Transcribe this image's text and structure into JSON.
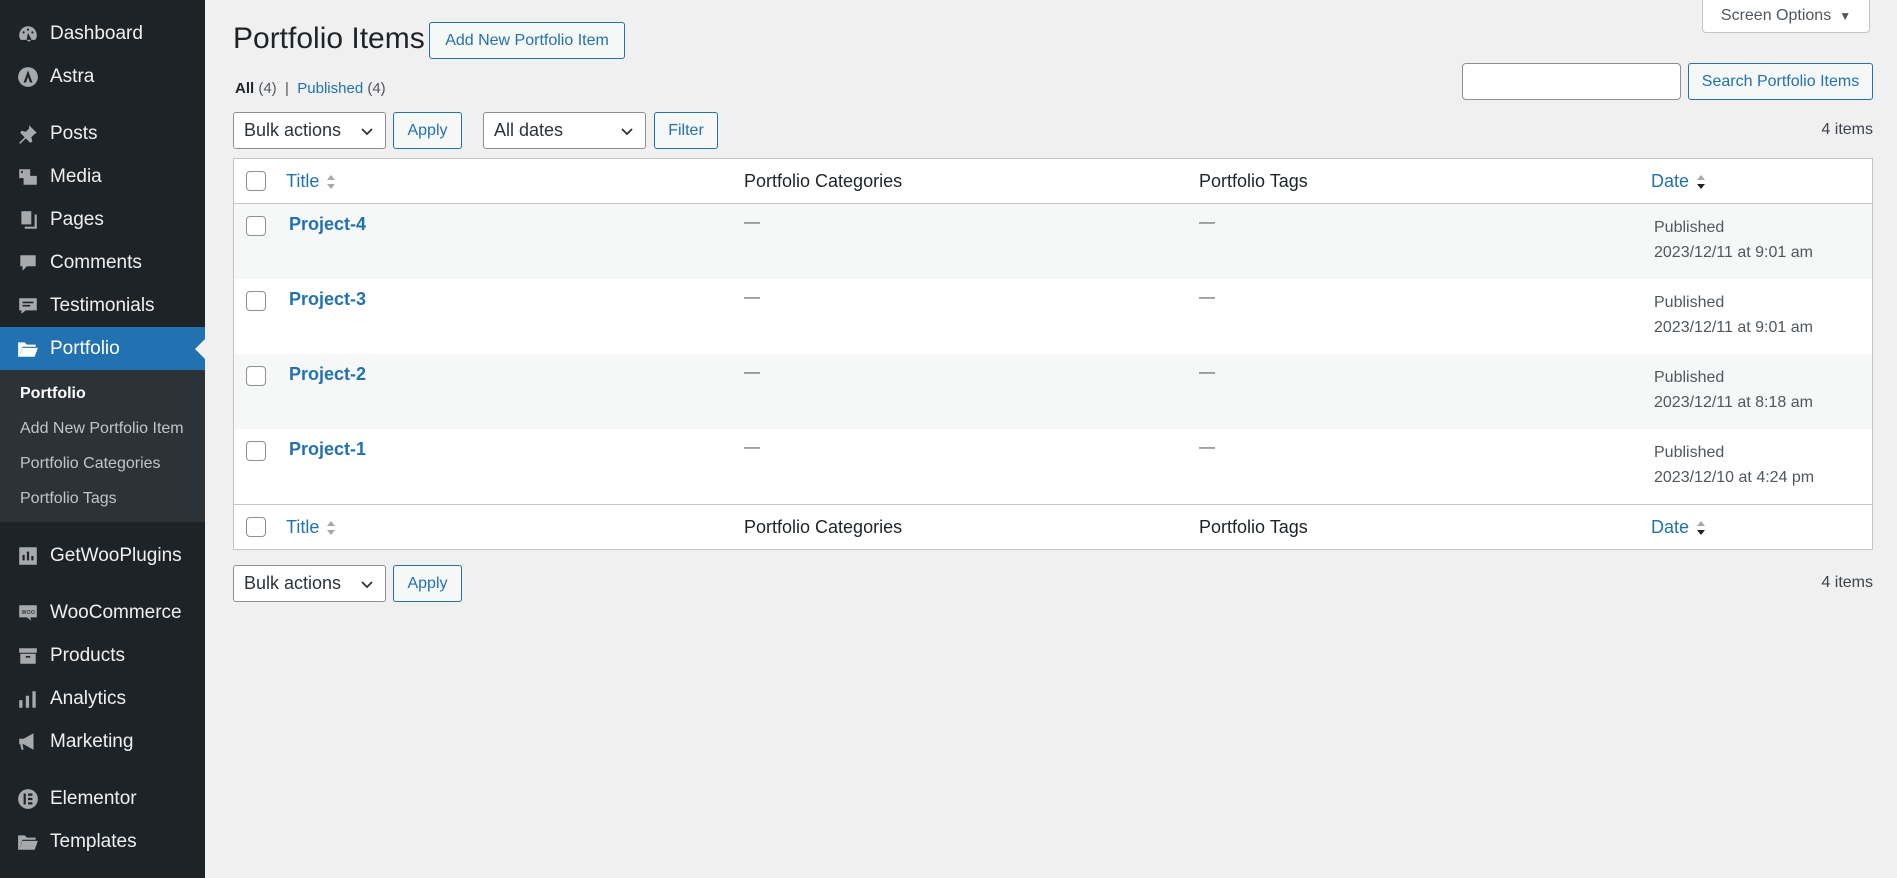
{
  "sidebar": {
    "items": [
      {
        "label": "Dashboard",
        "icon": "dashboard-icon"
      },
      {
        "label": "Astra",
        "icon": "astra-icon"
      },
      {
        "label": "Posts",
        "icon": "pin-icon"
      },
      {
        "label": "Media",
        "icon": "media-icon"
      },
      {
        "label": "Pages",
        "icon": "pages-icon"
      },
      {
        "label": "Comments",
        "icon": "comments-icon"
      },
      {
        "label": "Testimonials",
        "icon": "testimonials-icon"
      },
      {
        "label": "Portfolio",
        "icon": "folder-icon"
      },
      {
        "label": "GetWooPlugins",
        "icon": "getwooplugins-icon"
      },
      {
        "label": "WooCommerce",
        "icon": "woocommerce-icon"
      },
      {
        "label": "Products",
        "icon": "archive-icon"
      },
      {
        "label": "Analytics",
        "icon": "bar-chart-icon"
      },
      {
        "label": "Marketing",
        "icon": "megaphone-icon"
      },
      {
        "label": "Elementor",
        "icon": "elementor-icon"
      },
      {
        "label": "Templates",
        "icon": "folder-open-icon"
      }
    ],
    "submenu": [
      {
        "label": "Portfolio"
      },
      {
        "label": "Add New Portfolio Item"
      },
      {
        "label": "Portfolio Categories"
      },
      {
        "label": "Portfolio Tags"
      }
    ]
  },
  "header": {
    "title": "Portfolio Items",
    "add_new": "Add New Portfolio Item",
    "screen_options": "Screen Options"
  },
  "views": {
    "all_label": "All",
    "all_count": "(4)",
    "separator": "|",
    "published_label": "Published",
    "published_count": "(4)"
  },
  "search": {
    "button": "Search Portfolio Items",
    "value": ""
  },
  "toolbar": {
    "bulk_actions": "Bulk actions",
    "apply": "Apply",
    "dates": "All dates",
    "filter": "Filter",
    "items_count": "4 items"
  },
  "table": {
    "columns": {
      "title": "Title",
      "categories": "Portfolio Categories",
      "tags": "Portfolio Tags",
      "date": "Date"
    },
    "rows": [
      {
        "title": "Project-4",
        "categories": "—",
        "tags": "—",
        "status": "Published",
        "date": "2023/12/11 at 9:01 am"
      },
      {
        "title": "Project-3",
        "categories": "—",
        "tags": "—",
        "status": "Published",
        "date": "2023/12/11 at 9:01 am"
      },
      {
        "title": "Project-2",
        "categories": "—",
        "tags": "—",
        "status": "Published",
        "date": "2023/12/11 at 8:18 am"
      },
      {
        "title": "Project-1",
        "categories": "—",
        "tags": "—",
        "status": "Published",
        "date": "2023/12/10 at 4:24 pm"
      }
    ]
  },
  "colors": {
    "sidebar_bg": "#1d2327",
    "accent": "#2271b1",
    "page_bg": "#f0f0f1"
  }
}
